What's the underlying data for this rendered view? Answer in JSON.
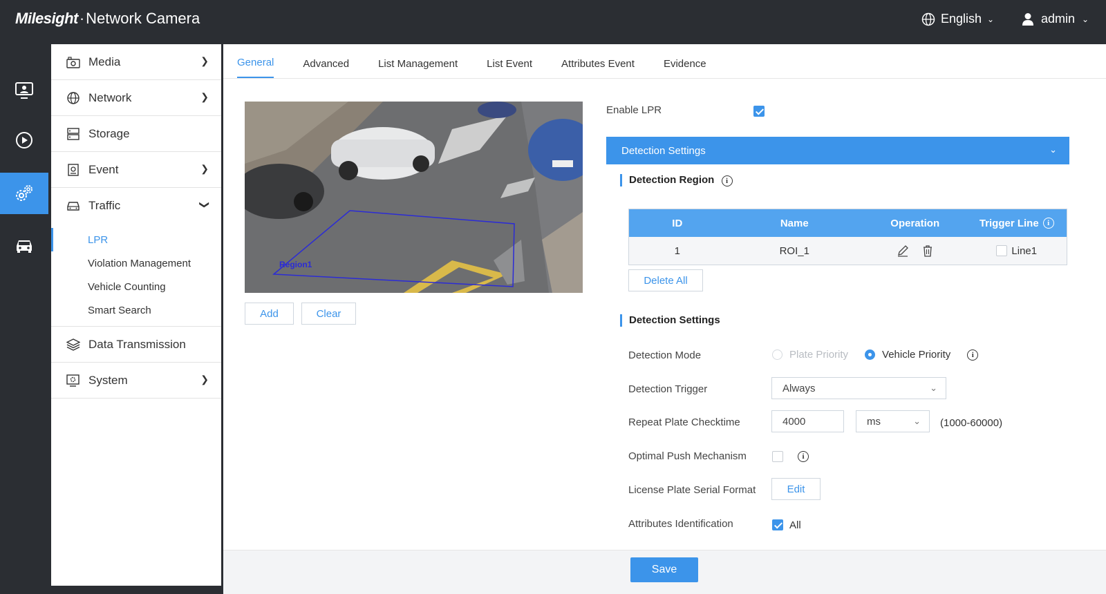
{
  "app": {
    "brand": "Milesight",
    "product": "Network Camera"
  },
  "header": {
    "language": "English",
    "user": "admin"
  },
  "rail": [
    "monitor-icon",
    "playback-icon",
    "settings-icon",
    "vehicle-icon"
  ],
  "menu": {
    "media": "Media",
    "network": "Network",
    "storage": "Storage",
    "event": "Event",
    "traffic": "Traffic",
    "traffic_sub": [
      "LPR",
      "Violation Management",
      "Vehicle Counting",
      "Smart Search"
    ],
    "data_transmission": "Data Transmission",
    "system": "System"
  },
  "tabs": [
    "General",
    "Advanced",
    "List Management",
    "List Event",
    "Attributes Event",
    "Evidence"
  ],
  "video": {
    "region_label": "Region1",
    "add": "Add",
    "clear": "Clear"
  },
  "enable_lpr": {
    "label": "Enable LPR",
    "checked": true
  },
  "accordion": {
    "title": "Detection Settings"
  },
  "detection_region": {
    "title": "Detection Region",
    "columns": [
      "ID",
      "Name",
      "Operation",
      "Trigger Line"
    ],
    "rows": [
      {
        "id": "1",
        "name": "ROI_1",
        "trigger_line": "Line1"
      }
    ],
    "delete_all": "Delete All"
  },
  "detection_settings": {
    "title": "Detection Settings",
    "mode_label": "Detection Mode",
    "mode_options": [
      "Plate Priority",
      "Vehicle Priority"
    ],
    "mode_selected": "Vehicle Priority",
    "trigger_label": "Detection Trigger",
    "trigger_value": "Always",
    "repeat_label": "Repeat Plate Checktime",
    "repeat_value": "4000",
    "repeat_unit": "ms",
    "repeat_range": "(1000-60000)",
    "push_label": "Optimal Push Mechanism",
    "serial_label": "License Plate Serial Format",
    "serial_btn": "Edit",
    "attr_label": "Attributes Identification",
    "attr_all": "All"
  },
  "footer": {
    "save": "Save"
  },
  "colors": {
    "accent": "#3c94ea",
    "dark": "#2b2e33"
  }
}
